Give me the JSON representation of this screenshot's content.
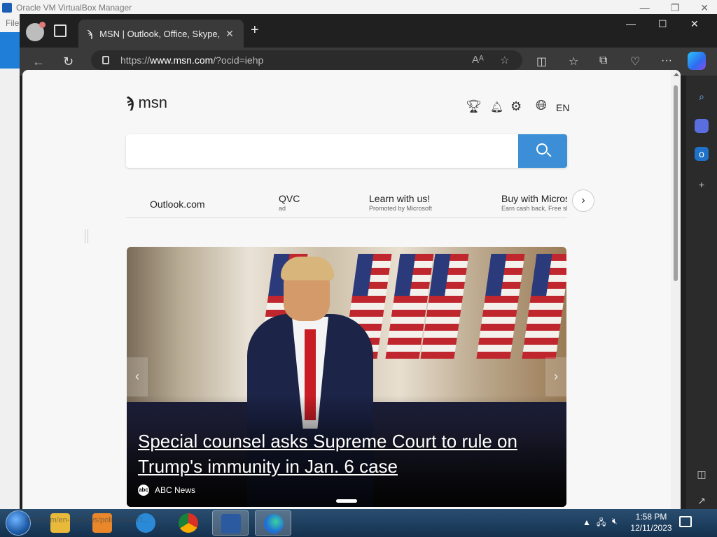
{
  "vbox": {
    "title": "Oracle VM VirtualBox Manager",
    "menu_file": "File"
  },
  "edge": {
    "tab_title": "MSN | Outlook, Office, Skype, Bing",
    "url_prefix": "https://",
    "url_domain": "www.msn.com",
    "url_path": "/?ocid=iehp"
  },
  "msn": {
    "logo_text": "msn",
    "language": "EN",
    "search_placeholder": "",
    "quick_links": [
      {
        "label": "Outlook.com",
        "sub": ""
      },
      {
        "label": "QVC",
        "sub": "ad"
      },
      {
        "label": "Learn with us!",
        "sub": "Promoted by Microsoft"
      },
      {
        "label": "Buy with Microsoft",
        "sub": "Earn cash back, Free shipping"
      }
    ],
    "hero": {
      "headline": "Special counsel asks Supreme Court to rule on Trump's immunity in Jan. 6 case",
      "source": "ABC News",
      "source_logo": "abc"
    }
  },
  "status_url": "msn.com/en-us/news/politics/AATl...",
  "taskbar": {
    "time": "1:58 PM",
    "date": "12/11/2023"
  },
  "colors": {
    "search_button": "#3c8fd6",
    "edge_chrome": "#202020",
    "taskbar": "#14314f"
  }
}
